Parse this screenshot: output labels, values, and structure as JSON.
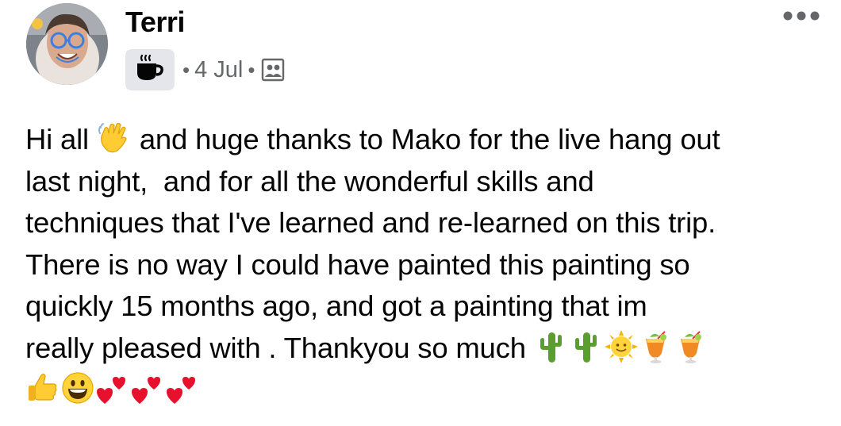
{
  "post": {
    "author": "Terri",
    "date": "4 Jul",
    "separator": "•",
    "activity_icon": "hot-beverage-icon",
    "audience_icon": "friends-of-friends-icon",
    "more_icon": "more-options-icon",
    "text_lines": [
      "Hi all",
      " and huge thanks to Mako for the live hang out",
      "last night,  and for all the wonderful skills and",
      "techniques that I've learned and re-learned on this trip.",
      "There is no way I could have painted this painting so",
      "quickly 15 months ago, and got a painting that im",
      "really pleased with . Thankyou so much"
    ],
    "emojis": {
      "wave": "waving-hand-emoji",
      "cactus": "cactus-emoji",
      "sun": "sun-with-face-emoji",
      "drink": "tropical-drink-emoji",
      "thumbs": "thumbs-up-emoji",
      "grin": "grinning-face-emoji",
      "hearts": "two-hearts-emoji"
    }
  },
  "colors": {
    "text": "#050505",
    "secondary": "#65676b",
    "chip_bg": "#e4e6eb",
    "emoji_yellow": "#ffcc33",
    "cactus_green": "#5a9e2f",
    "heart_red": "#e8112d"
  }
}
